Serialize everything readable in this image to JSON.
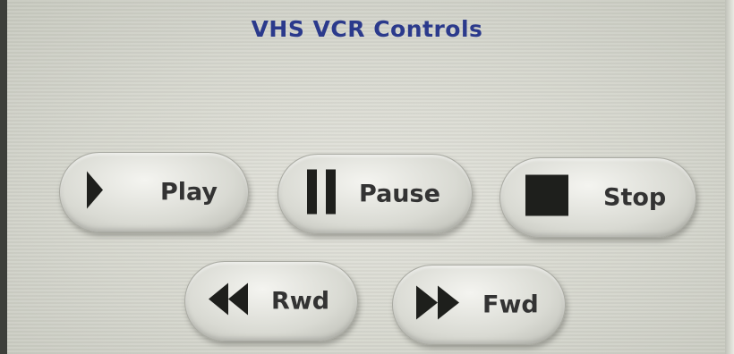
{
  "screen": {
    "title": "VHS VCR Controls"
  },
  "controls": {
    "play": {
      "label": "Play",
      "icon": "play-icon"
    },
    "pause": {
      "label": "Pause",
      "icon": "pause-icon"
    },
    "stop": {
      "label": "Stop",
      "icon": "stop-icon"
    },
    "rwd": {
      "label": "Rwd",
      "icon": "rewind-icon"
    },
    "fwd": {
      "label": "Fwd",
      "icon": "fast-forward-icon"
    }
  },
  "colors": {
    "title": "#2b3a8c",
    "label": "#333333",
    "icon": "#1e1f1c",
    "background": "#d6d7ce"
  }
}
